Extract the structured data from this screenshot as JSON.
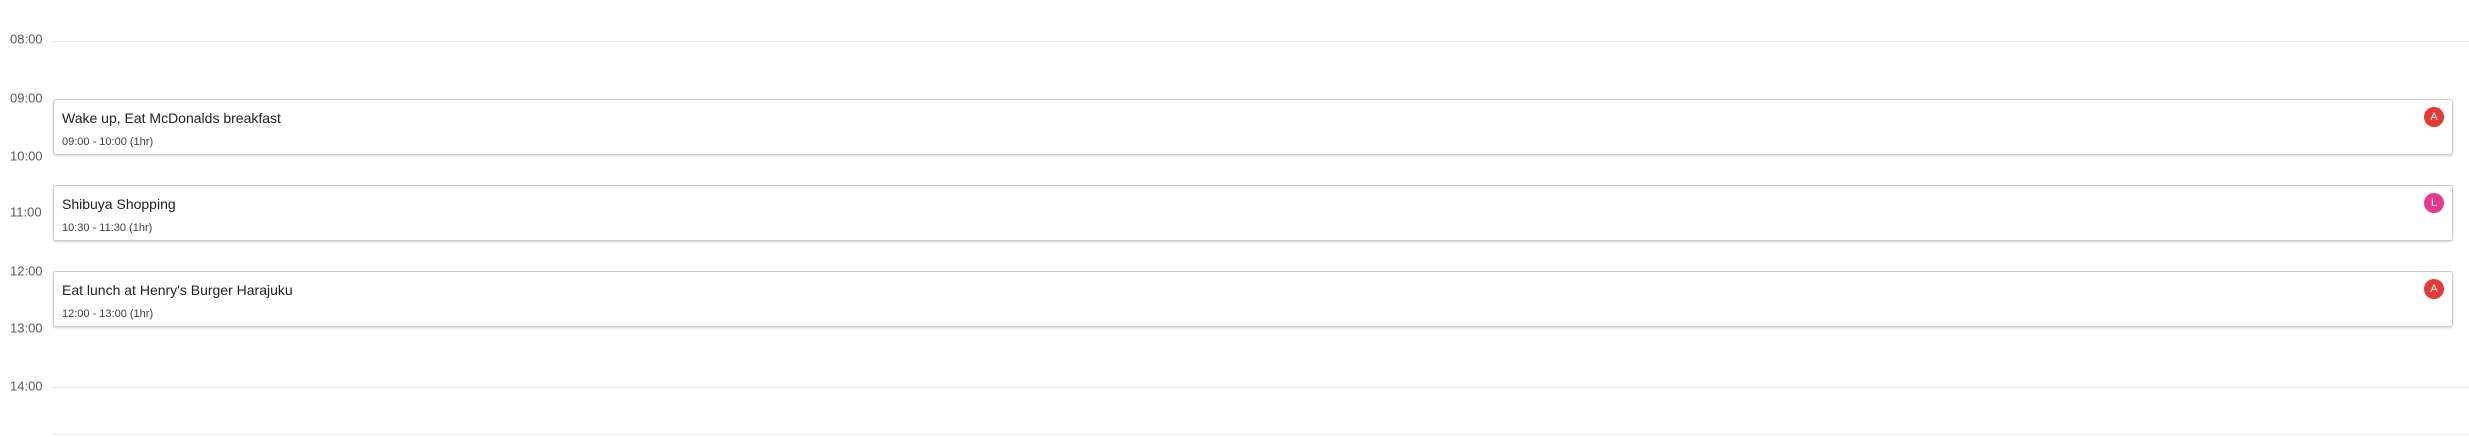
{
  "timeline": {
    "hours": [
      "08:00",
      "09:00",
      "10:00",
      "11:00",
      "12:00",
      "13:00",
      "14:00"
    ]
  },
  "events": [
    {
      "title": "Wake up, Eat McDonalds breakfast",
      "time": "09:00 - 10:00 (1hr)",
      "avatar": {
        "initial": "A",
        "color": "#e53935"
      }
    },
    {
      "title": "Shibuya Shopping",
      "time": "10:30 - 11:30 (1hr)",
      "avatar": {
        "initial": "L",
        "color": "#e8398f"
      }
    },
    {
      "title": "Eat lunch at Henry's Burger Harajuku",
      "time": "12:00 - 13:00 (1hr)",
      "avatar": {
        "initial": "A",
        "color": "#e53935"
      }
    }
  ]
}
